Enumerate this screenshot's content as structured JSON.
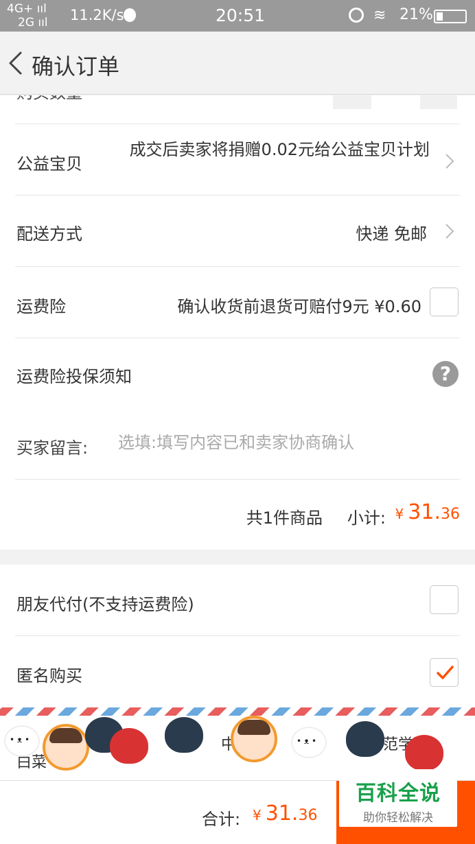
{
  "status_bar": {
    "network1": "4G+ ııl",
    "network2": "2G ııl",
    "speed": "11.2K/s",
    "time": "20:51",
    "battery": "21%"
  },
  "nav": {
    "title": "确认订单"
  },
  "order": {
    "partial_label": "购买数量",
    "charity_label": "公益宝贝",
    "charity_value": "成交后卖家将捐赠0.02元给公益宝贝计划",
    "delivery_label": "配送方式",
    "delivery_value": "快递 免邮",
    "insurance_label": "运费险",
    "insurance_value": "确认收货前退货可赔付9元 ¥0.60",
    "insurance_checked": false,
    "notice_label": "运费险投保须知",
    "message_label": "买家留言:",
    "message_placeholder": "选填:填写内容已和卖家协商确认",
    "count_text": "共1件商品",
    "subtotal_label": "小计:",
    "subtotal_currency": "¥",
    "subtotal_int": "31.",
    "subtotal_dec": "36"
  },
  "options": {
    "friend_pay_label": "朋友代付(不支持运费险)",
    "friend_pay_checked": false,
    "anonymous_label": "匿名购买",
    "anonymous_checked": true
  },
  "banner": {
    "text1": "中",
    "text2": "范学院",
    "text3": "白菜"
  },
  "bottom": {
    "total_label": "合计:",
    "total_currency": "¥",
    "total_int": "31.",
    "total_dec": "36"
  },
  "watermark": {
    "line1": "百科全说",
    "line2": "助你轻松解决"
  },
  "colors": {
    "accent": "#ff5000",
    "watermark_green": "#18a04a"
  }
}
